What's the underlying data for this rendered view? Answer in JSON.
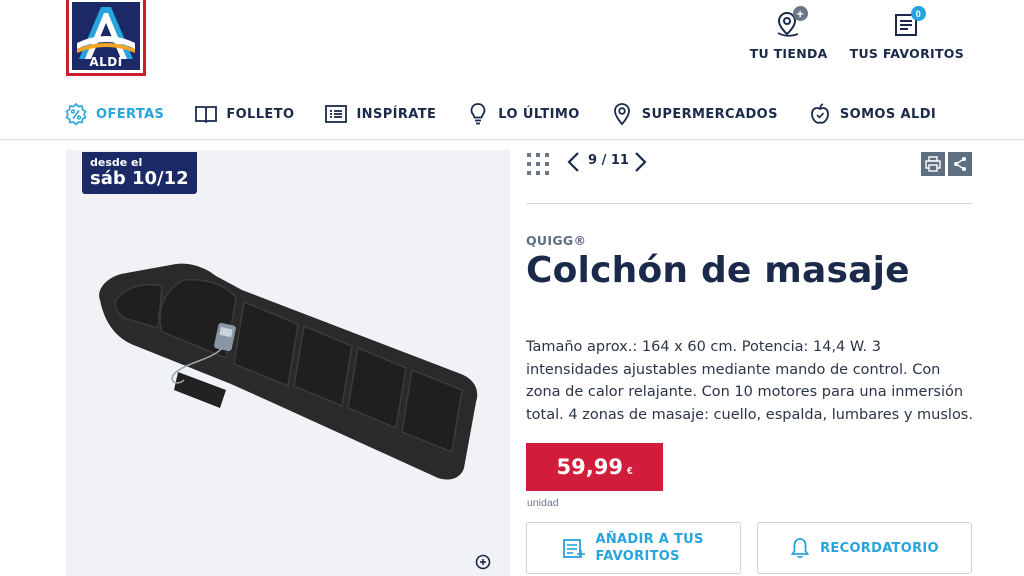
{
  "logo": {
    "text": "ALDI"
  },
  "header_links": [
    {
      "label": "TU TIENDA",
      "icon": "store-location-icon"
    },
    {
      "label": "TUS FAVORITOS",
      "icon": "favorites-list-icon",
      "badge": "0"
    }
  ],
  "nav": [
    {
      "label": "OFERTAS",
      "icon": "percent-badge-icon",
      "active": true
    },
    {
      "label": "FOLLETO",
      "icon": "open-book-icon"
    },
    {
      "label": "INSPÍRATE",
      "icon": "list-card-icon"
    },
    {
      "label": "LO ÚLTIMO",
      "icon": "lightbulb-icon"
    },
    {
      "label": "SUPERMERCADOS",
      "icon": "map-pin-icon"
    },
    {
      "label": "SOMOS ALDI",
      "icon": "apple-icon"
    }
  ],
  "date_badge": {
    "small": "desde el",
    "big": "sáb 10/12"
  },
  "pager": {
    "count": "9 / 11"
  },
  "product": {
    "brand": "QUIGG®",
    "title": "Colchón de masaje",
    "description": "Tamaño aprox.: 164 x 60 cm. Potencia: 14,4 W. 3 intensidades ajustables mediante mando de control. Con zona de calor relajante. Con 10 motores para una inmersión total. 4 zonas de masaje: cuello, espalda, lumbares y muslos.",
    "price": "59,99",
    "currency": "€",
    "unit": "unidad"
  },
  "buttons": {
    "favorites": "AÑADIR A TUS FAVORITOS",
    "reminder": "RECORDATORIO"
  },
  "colors": {
    "navy": "#1b2a4a",
    "accent_blue": "#27a3dd",
    "price_red": "#d11d3b",
    "logo_red": "#c8202f"
  }
}
